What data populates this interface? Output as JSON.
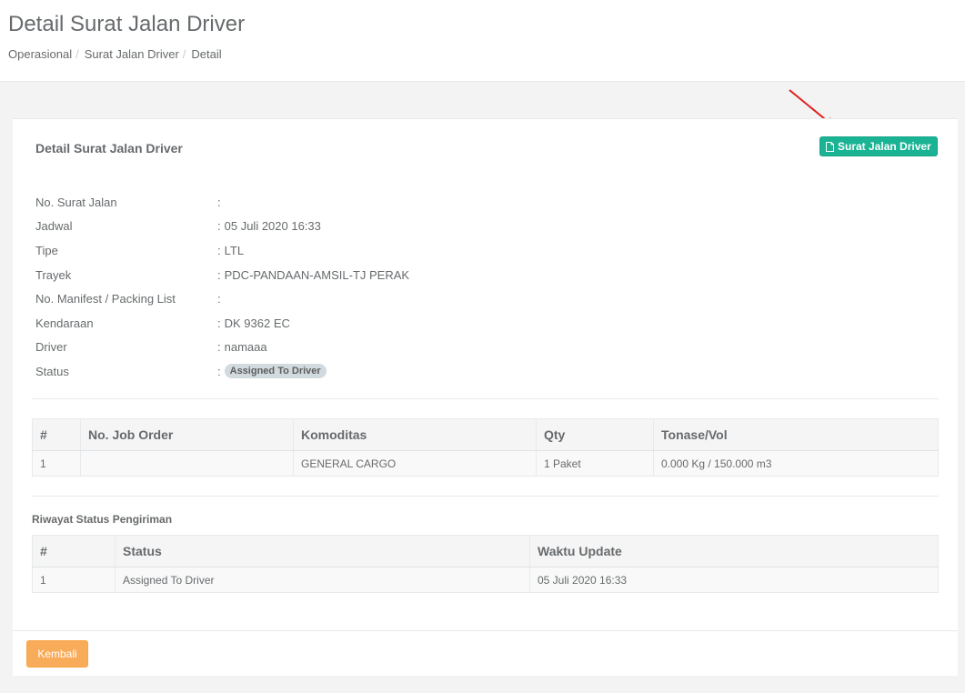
{
  "header": {
    "title": "Detail Surat Jalan Driver",
    "breadcrumb": [
      "Operasional",
      "Surat Jalan Driver",
      "Detail"
    ]
  },
  "panel": {
    "title": "Detail Surat Jalan Driver",
    "print_button": "Surat Jalan Driver",
    "fields": [
      {
        "label": "No. Surat Jalan",
        "value": ""
      },
      {
        "label": "Jadwal",
        "value": "05 Juli 2020 16:33"
      },
      {
        "label": "Tipe",
        "value": "LTL"
      },
      {
        "label": "Trayek",
        "value": "PDC-PANDAAN-AMSIL-TJ PERAK"
      },
      {
        "label": "No. Manifest / Packing List",
        "value": ""
      },
      {
        "label": "Kendaraan",
        "value": "DK 9362 EC"
      },
      {
        "label": "Driver",
        "value": "namaaa"
      },
      {
        "label": "Status",
        "value": "Assigned To Driver"
      }
    ]
  },
  "job_table": {
    "headers": [
      "#",
      "No. Job Order",
      "Komoditas",
      "Qty",
      "Tonase/Vol"
    ],
    "rows": [
      [
        "1",
        "",
        "GENERAL CARGO",
        "1 Paket",
        "0.000 Kg / 150.000 m3"
      ]
    ]
  },
  "history": {
    "title": "Riwayat Status Pengiriman",
    "headers": [
      "#",
      "Status",
      "Waktu Update"
    ],
    "rows": [
      [
        "1",
        "Assigned To Driver",
        "05 Juli 2020 16:33"
      ]
    ]
  },
  "footer": {
    "back_button": "Kembali"
  },
  "colors": {
    "primary": "#1ab394",
    "warning": "#f8ac59",
    "annotation_arrow": "#e02020"
  }
}
